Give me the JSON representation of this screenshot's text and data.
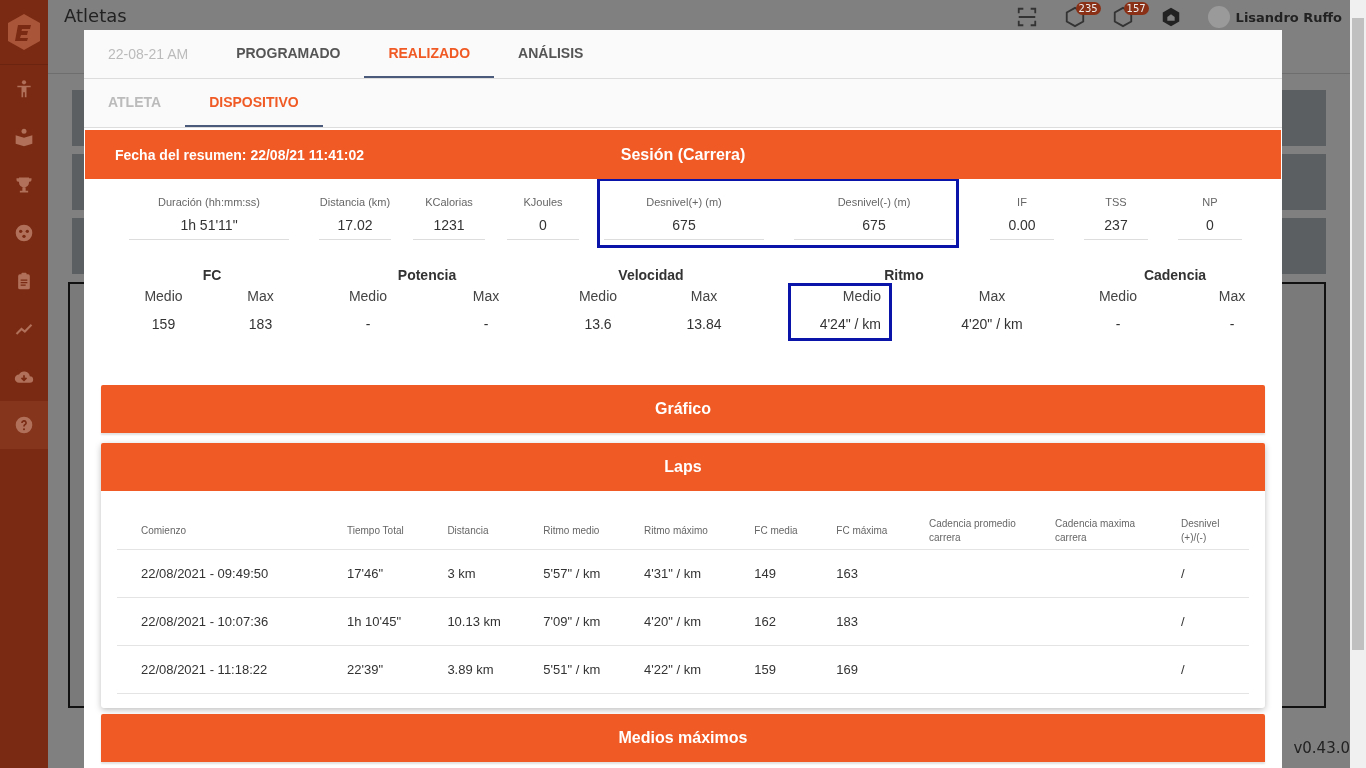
{
  "app": {
    "page_title": "Atletas",
    "badges": [
      {
        "count": "235"
      },
      {
        "count": "157"
      }
    ],
    "user_name": "Lisandro Ruffo",
    "version": "v0.43.0"
  },
  "modal": {
    "date_label": "22-08-21 AM",
    "tabs": [
      {
        "label": "PROGRAMADO",
        "selected": false
      },
      {
        "label": "REALIZADO",
        "selected": true
      },
      {
        "label": "ANÁLISIS",
        "selected": false
      }
    ],
    "subtabs": [
      {
        "label": "ATLETA",
        "selected": false
      },
      {
        "label": "DISPOSITIVO",
        "selected": true
      }
    ],
    "session": {
      "summary_date": "Fecha del resumen: 22/08/21 11:41:02",
      "title": "Sesión (Carrera)",
      "fields": [
        {
          "label": "Duración (hh:mm:ss)",
          "value": "1h 51'11\"",
          "highlighted": false
        },
        {
          "label": "Distancia (km)",
          "value": "17.02",
          "highlighted": false
        },
        {
          "label": "KCalorias",
          "value": "1231",
          "highlighted": false
        },
        {
          "label": "KJoules",
          "value": "0",
          "highlighted": false
        },
        {
          "label": "Desnivel(+) (m)",
          "value": "675",
          "highlighted": true
        },
        {
          "label": "Desnivel(-) (m)",
          "value": "675",
          "highlighted": true
        },
        {
          "label": "IF",
          "value": "0.00",
          "highlighted": false
        },
        {
          "label": "TSS",
          "value": "237",
          "highlighted": false
        },
        {
          "label": "NP",
          "value": "0",
          "highlighted": false
        }
      ],
      "metrics": [
        {
          "title": "FC",
          "stats": [
            {
              "label": "Medio",
              "value": "159",
              "highlighted": false
            },
            {
              "label": "Max",
              "value": "183",
              "highlighted": false
            }
          ]
        },
        {
          "title": "Potencia",
          "stats": [
            {
              "label": "Medio",
              "value": "-",
              "highlighted": false
            },
            {
              "label": "Max",
              "value": "-",
              "highlighted": false
            }
          ]
        },
        {
          "title": "Velocidad",
          "stats": [
            {
              "label": "Medio",
              "value": "13.6",
              "highlighted": false
            },
            {
              "label": "Max",
              "value": "13.84",
              "highlighted": false
            }
          ]
        },
        {
          "title": "Ritmo",
          "stats": [
            {
              "label": "Medio",
              "value": "4'24\" / km",
              "highlighted": true
            },
            {
              "label": "Max",
              "value": "4'20\" / km",
              "highlighted": false
            }
          ]
        },
        {
          "title": "Cadencia",
          "stats": [
            {
              "label": "Medio",
              "value": "-",
              "highlighted": false
            },
            {
              "label": "Max",
              "value": "-",
              "highlighted": false
            }
          ]
        }
      ]
    },
    "chart_section": {
      "title": "Gráfico"
    },
    "laps": {
      "title": "Laps",
      "columns": [
        "Comienzo",
        "Tiempo Total",
        "Distancia",
        "Ritmo medio",
        "Ritmo máximo",
        "FC media",
        "FC máxima",
        "Cadencia promedio carrera",
        "Cadencia maxima carrera",
        "Desnivel (+)/(-)"
      ],
      "rows": [
        [
          "22/08/2021 - 09:49:50",
          "17'46\"",
          "3 km",
          "5'57\" / km",
          "4'31\" / km",
          "149",
          "163",
          "",
          "",
          "/"
        ],
        [
          "22/08/2021 - 10:07:36",
          "1h 10'45\"",
          "10.13 km",
          "7'09\" / km",
          "4'20\" / km",
          "162",
          "183",
          "",
          "",
          "/"
        ],
        [
          "22/08/2021 - 11:18:22",
          "22'39\"",
          "3.89 km",
          "5'51\" / km",
          "4'22\" / km",
          "159",
          "169",
          "",
          "",
          "/"
        ]
      ]
    },
    "max_section": {
      "title": "Medios máximos"
    }
  }
}
